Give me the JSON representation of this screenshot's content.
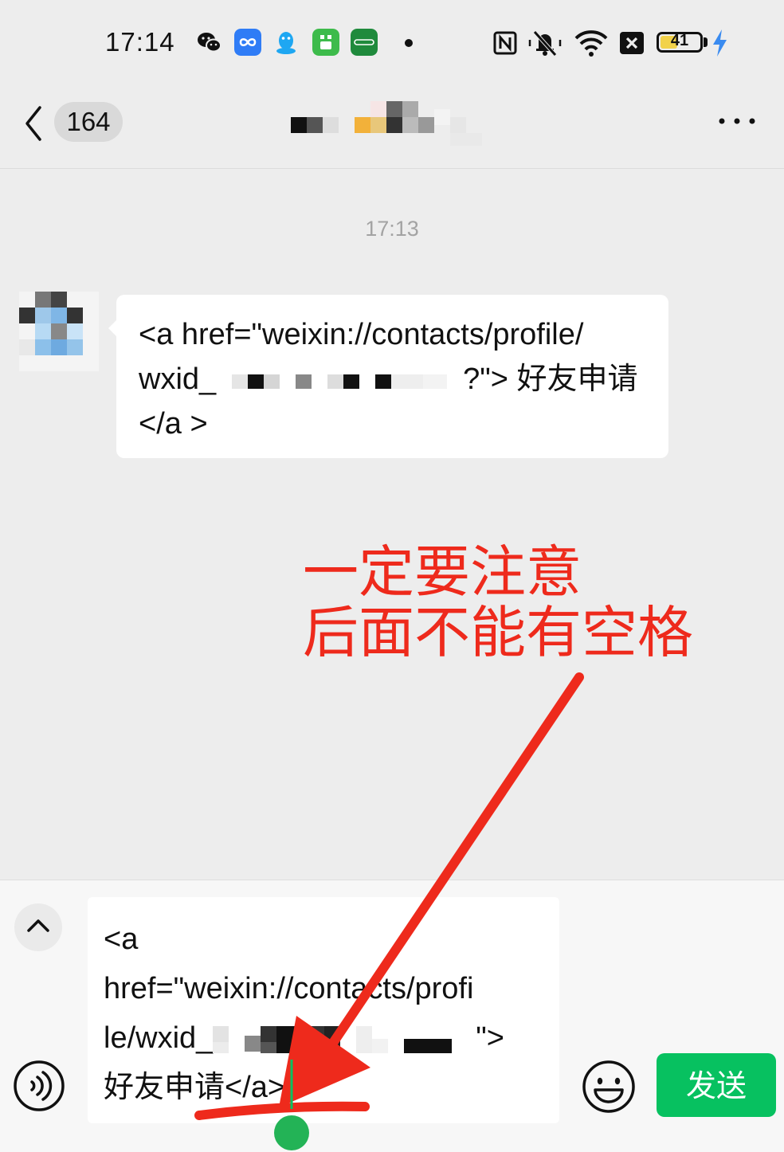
{
  "status_bar": {
    "time": "17:14",
    "battery_level": "41"
  },
  "header": {
    "unread_count": "164"
  },
  "chat": {
    "timestamp": "17:13",
    "message": {
      "line1": "<a href=\"weixin://contacts/profile/",
      "line2_prefix": "wxid_",
      "line2_suffix": "?\"> 好友申请",
      "line3": "</a >"
    }
  },
  "annotation": {
    "line1": "一定要注意",
    "line2": "后面不能有空格",
    "color": "#ee2a1c"
  },
  "input": {
    "line1": "<a",
    "line2": "href=\"weixin://contacts/profi",
    "line3_prefix": "le/wxid_",
    "line3_suffix": "\">",
    "line4": "好友申请</a>",
    "send_label": "发送"
  },
  "colors": {
    "accent": "#07c160",
    "background": "#ededed"
  }
}
